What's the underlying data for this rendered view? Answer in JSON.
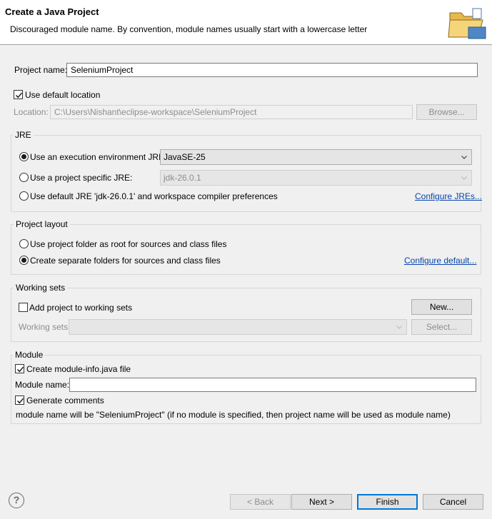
{
  "header": {
    "title": "Create a Java Project",
    "message": "Discouraged module name. By convention, module names usually start with a lowercase letter"
  },
  "project_name": {
    "label": "Project name:",
    "value": "SeleniumProject"
  },
  "location": {
    "use_default_label": "Use default location",
    "use_default_checked": true,
    "label": "Location:",
    "value": "C:\\Users\\Nishant\\eclipse-workspace\\SeleniumProject",
    "browse_label": "Browse..."
  },
  "jre": {
    "title": "JRE",
    "option_env_label": "Use an execution environment JRE:",
    "env_value": "JavaSE-25",
    "option_specific_label": "Use a project specific JRE:",
    "specific_value": "jdk-26.0.1",
    "option_default_label": "Use default JRE 'jdk-26.0.1' and workspace compiler preferences",
    "configure_link": "Configure JREs...",
    "selected": "env"
  },
  "layout": {
    "title": "Project layout",
    "option_root_label": "Use project folder as root for sources and class files",
    "option_separate_label": "Create separate folders for sources and class files",
    "configure_link": "Configure default...",
    "selected": "separate"
  },
  "working_sets": {
    "title": "Working sets",
    "add_label": "Add project to working sets",
    "add_checked": false,
    "new_label": "New...",
    "sets_label": "Working sets:",
    "sets_value": "",
    "select_label": "Select..."
  },
  "module": {
    "title": "Module",
    "create_info_label": "Create module-info.java file",
    "create_info_checked": true,
    "name_label": "Module name:",
    "name_value": "",
    "generate_comments_label": "Generate comments",
    "generate_comments_checked": true,
    "note": "module name will be \"SeleniumProject\"  (if no module is specified, then project name will be used as module name)"
  },
  "footer": {
    "help_glyph": "?",
    "back_label": "< Back",
    "next_label": "Next >",
    "finish_label": "Finish",
    "cancel_label": "Cancel"
  },
  "colors": {
    "link": "#0645ad",
    "default_button_border": "#0078d7"
  }
}
